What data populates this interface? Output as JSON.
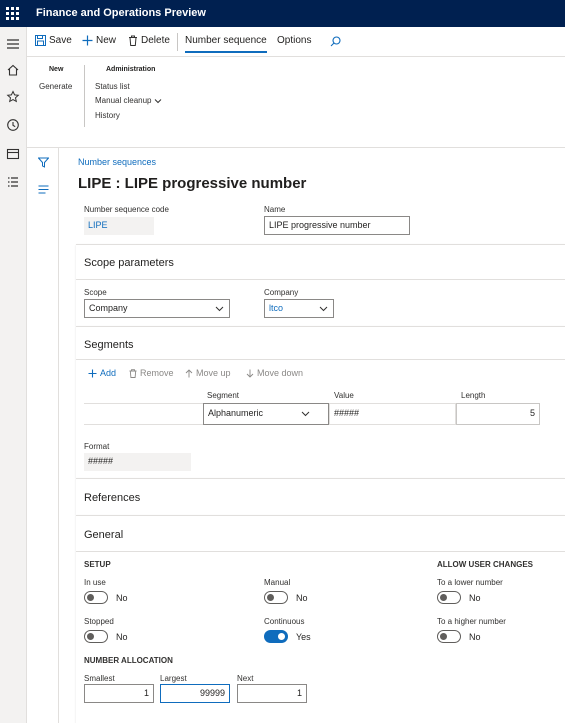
{
  "app": {
    "title": "Finance and Operations Preview"
  },
  "actionbar": {
    "save": "Save",
    "new": "New",
    "delete": "Delete",
    "tab_number_sequence": "Number sequence",
    "tab_options": "Options"
  },
  "ribbon": {
    "new_group": "New",
    "generate": "Generate",
    "admin_group": "Administration",
    "status_list": "Status list",
    "manual_cleanup": "Manual cleanup",
    "history": "History"
  },
  "page": {
    "breadcrumb": "Number sequences",
    "title": "LIPE : LIPE progressive number"
  },
  "header_fields": {
    "code_label": "Number sequence code",
    "code_value": "LIPE",
    "name_label": "Name",
    "name_value": "LIPE progressive number"
  },
  "scope": {
    "title": "Scope parameters",
    "scope_label": "Scope",
    "scope_value": "Company",
    "company_label": "Company",
    "company_value": "ltco"
  },
  "segments": {
    "title": "Segments",
    "add": "Add",
    "remove": "Remove",
    "move_up": "Move up",
    "move_down": "Move down",
    "columns": {
      "segment": "Segment",
      "value": "Value",
      "length": "Length"
    },
    "row": {
      "segment": "Alphanumeric",
      "value": "#####",
      "length": "5"
    },
    "format_label": "Format",
    "format_value": "#####"
  },
  "references": {
    "title": "References"
  },
  "general": {
    "title": "General",
    "setup_title": "SETUP",
    "in_use_label": "In use",
    "in_use_value": "No",
    "manual_label": "Manual",
    "manual_value": "No",
    "stopped_label": "Stopped",
    "stopped_value": "No",
    "continuous_label": "Continuous",
    "continuous_value": "Yes",
    "allow_title": "ALLOW USER CHANGES",
    "lower_label": "To a lower number",
    "lower_value": "No",
    "higher_label": "To a higher number",
    "higher_value": "No",
    "allocation_title": "NUMBER ALLOCATION",
    "smallest_label": "Smallest",
    "smallest_value": "1",
    "largest_label": "Largest",
    "largest_value": "99999",
    "next_label": "Next",
    "next_value": "1"
  },
  "colors": {
    "header": "#002050",
    "accent": "#0f6cbd"
  }
}
